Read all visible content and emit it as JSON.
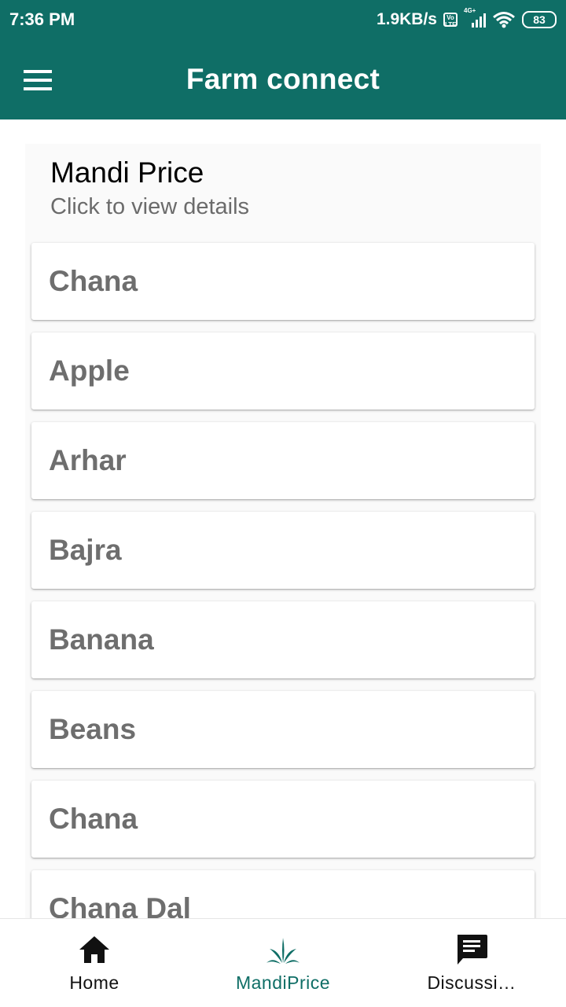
{
  "status_bar": {
    "time": "7:36 PM",
    "net_speed": "1.9KB/s",
    "volte_label": "Vo LTE",
    "network_type": "4G+",
    "battery": "83"
  },
  "app_bar": {
    "title": "Farm connect",
    "menu_icon": "hamburger-menu-icon"
  },
  "section": {
    "title": "Mandi Price",
    "subtitle": "Click to view details"
  },
  "commodities": [
    "Chana",
    "Apple",
    "Arhar",
    "Bajra",
    "Banana",
    "Beans",
    "Chana",
    "Chana Dal"
  ],
  "bottom_nav": {
    "items": [
      {
        "label": "Home",
        "icon": "home-icon"
      },
      {
        "label": "MandiPrice",
        "icon": "plant-icon",
        "active": true
      },
      {
        "label": "Discussi…",
        "icon": "chat-icon"
      }
    ]
  },
  "colors": {
    "primary": "#0f6e66",
    "item_text": "#6e6e6e",
    "subtitle": "#6b6b6b"
  }
}
